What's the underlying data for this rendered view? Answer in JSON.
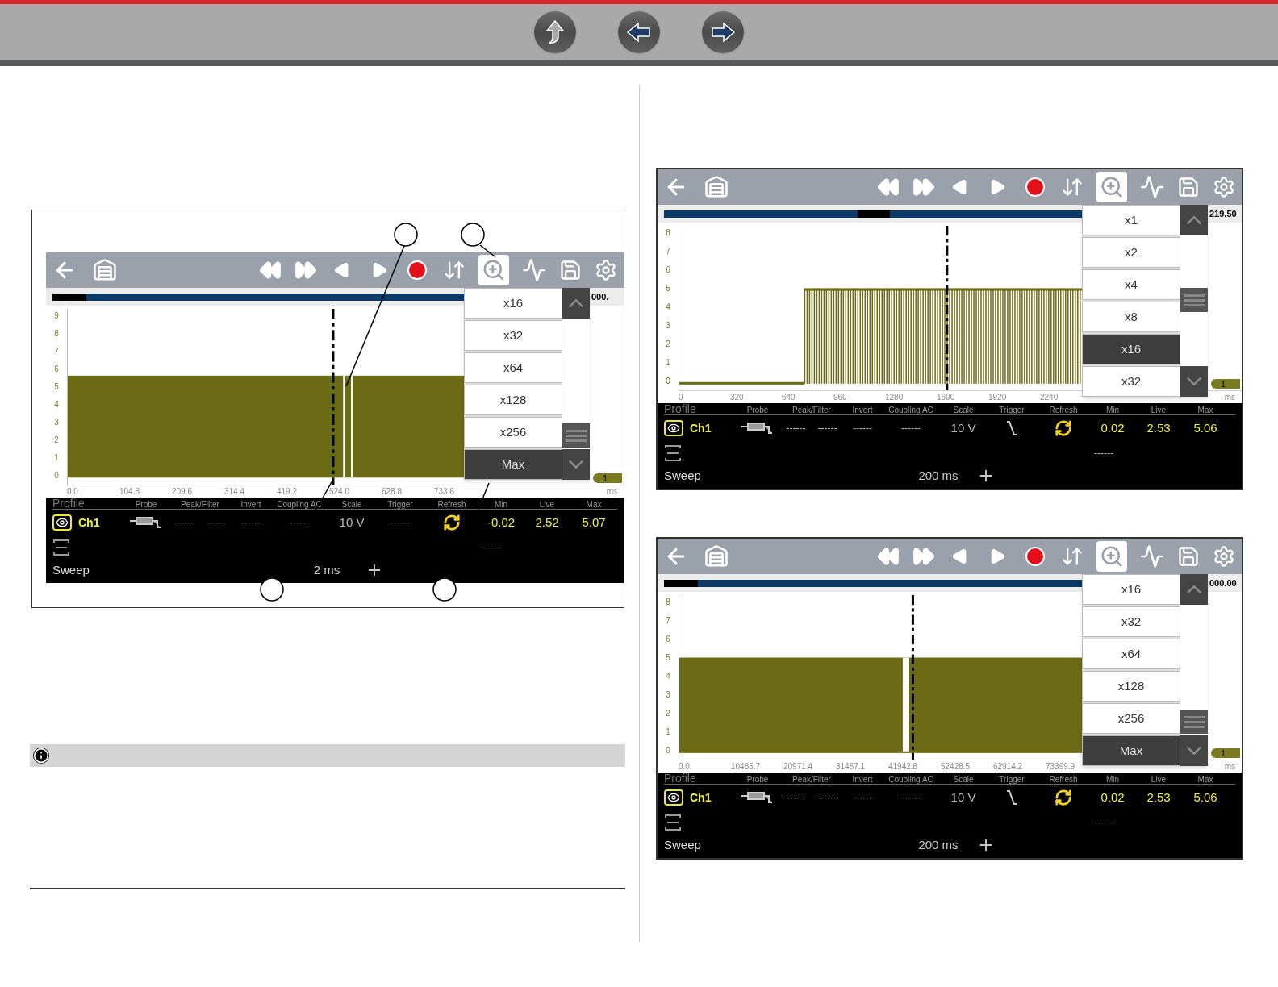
{
  "screens": [
    {
      "readout": "000.",
      "y_ticks": [
        "9",
        "8",
        "7",
        "6",
        "5",
        "4",
        "3",
        "2",
        "1",
        "0"
      ],
      "x_ticks": [
        "0.0",
        "104.8",
        "209.6",
        "314.4",
        "419.2",
        "524.0",
        "628.8",
        "733.6"
      ],
      "x_unit": "ms",
      "marker": "1",
      "zoom_menu": [
        {
          "label": "x16",
          "selected": false
        },
        {
          "label": "x32",
          "selected": false
        },
        {
          "label": "x64",
          "selected": false
        },
        {
          "label": "x128",
          "selected": false
        },
        {
          "label": "x256",
          "selected": false
        },
        {
          "label": "Max",
          "selected": true
        }
      ],
      "headers": [
        "Profile",
        "Probe",
        "Peak/Filter",
        "Invert",
        "Coupling AC",
        "Scale",
        "Trigger",
        "Refresh",
        "Min",
        "Live",
        "Max"
      ],
      "channel": {
        "name": "Ch1",
        "peak_filter": [
          "------",
          "------"
        ],
        "invert": "------",
        "coupling": "------",
        "scale": "10 V",
        "trigger": {
          "kind": "text",
          "text": "------"
        },
        "refresh_sub": "------",
        "min": "-0.02",
        "live": "2.52",
        "max": "5.07"
      },
      "sweep_label": "Sweep",
      "sweep": "2 ms"
    },
    {
      "readout": "219.50",
      "y_ticks": [
        "8",
        "7",
        "6",
        "5",
        "4",
        "3",
        "2",
        "1",
        "0"
      ],
      "x_ticks": [
        "0",
        "320",
        "640",
        "960",
        "1280",
        "1600",
        "1920",
        "2240"
      ],
      "x_unit": "ms",
      "marker": "1",
      "zoom_menu": [
        {
          "label": "x1",
          "selected": false
        },
        {
          "label": "x2",
          "selected": false
        },
        {
          "label": "x4",
          "selected": false
        },
        {
          "label": "x8",
          "selected": false
        },
        {
          "label": "x16",
          "selected": true
        },
        {
          "label": "x32",
          "selected": false
        }
      ],
      "headers": [
        "Profile",
        "Probe",
        "Peak/Filter",
        "Invert",
        "Coupling AC",
        "Scale",
        "Trigger",
        "Refresh",
        "Min",
        "Live",
        "Max"
      ],
      "channel": {
        "name": "Ch1",
        "peak_filter": [
          "------",
          "------"
        ],
        "invert": "------",
        "coupling": "------",
        "scale": "10 V",
        "trigger": {
          "kind": "falling-edge"
        },
        "refresh_sub": "------",
        "min": "0.02",
        "live": "2.53",
        "max": "5.06"
      },
      "sweep_label": "Sweep",
      "sweep": "200 ms"
    },
    {
      "readout": "000.00",
      "y_ticks": [
        "8",
        "7",
        "6",
        "5",
        "4",
        "3",
        "2",
        "1",
        "0"
      ],
      "x_ticks": [
        "0.0",
        "10485.7",
        "20971.4",
        "31457.1",
        "41942.8",
        "52428.5",
        "62914.2",
        "73399.9"
      ],
      "x_unit": "ms",
      "marker": "1",
      "zoom_menu": [
        {
          "label": "x16",
          "selected": false
        },
        {
          "label": "x32",
          "selected": false
        },
        {
          "label": "x64",
          "selected": false
        },
        {
          "label": "x128",
          "selected": false
        },
        {
          "label": "x256",
          "selected": false
        },
        {
          "label": "Max",
          "selected": true
        }
      ],
      "headers": [
        "Profile",
        "Probe",
        "Peak/Filter",
        "Invert",
        "Coupling AC",
        "Scale",
        "Trigger",
        "Refresh",
        "Min",
        "Live",
        "Max"
      ],
      "channel": {
        "name": "Ch1",
        "peak_filter": [
          "------",
          "------"
        ],
        "invert": "------",
        "coupling": "------",
        "scale": "10 V",
        "trigger": {
          "kind": "falling-edge"
        },
        "refresh_sub": "------",
        "min": "0.02",
        "live": "2.53",
        "max": "5.06"
      },
      "sweep_label": "Sweep",
      "sweep": "200 ms"
    }
  ]
}
